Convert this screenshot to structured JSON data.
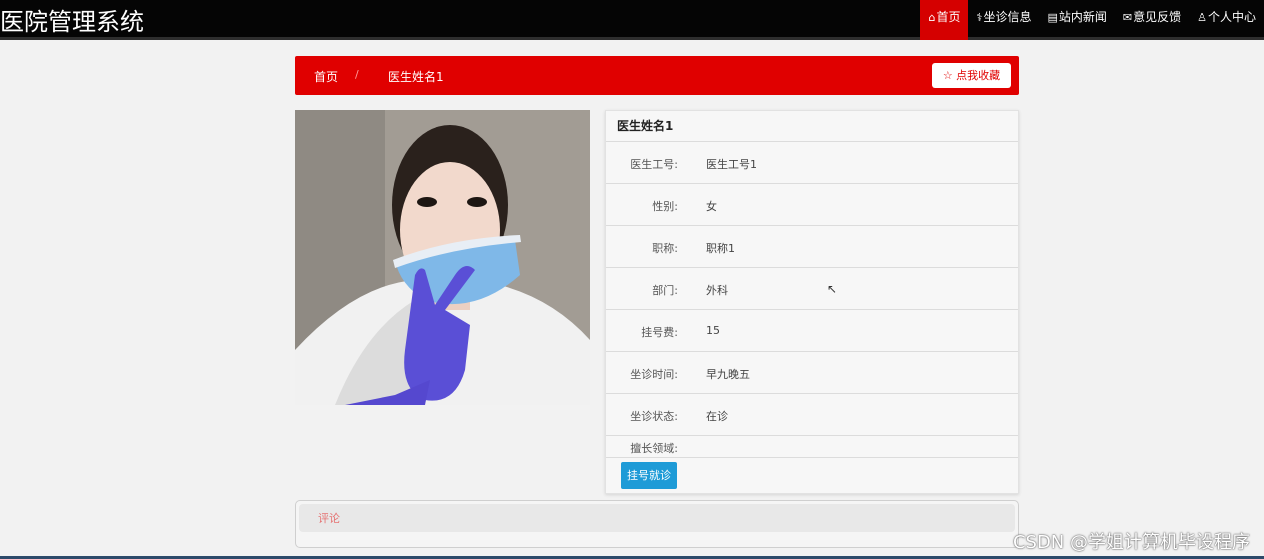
{
  "header": {
    "brand": "医院管理系统",
    "nav": [
      {
        "icon": "⌂",
        "label": "首页",
        "active": true
      },
      {
        "icon": "⚕",
        "label": "坐诊信息"
      },
      {
        "icon": "▤",
        "label": "站内新闻"
      },
      {
        "icon": "✉",
        "label": "意见反馈"
      },
      {
        "icon": "♙",
        "label": "个人中心"
      }
    ]
  },
  "breadcrumb": {
    "home": "首页",
    "separator": "/",
    "current": "医生姓名1",
    "favorite_button": "☆ 点我收藏"
  },
  "doctor": {
    "name": "医生姓名1",
    "fields": [
      {
        "label": "医生工号:",
        "value": "医生工号1"
      },
      {
        "label": "性别:",
        "value": "女"
      },
      {
        "label": "职称:",
        "value": "职称1"
      },
      {
        "label": "部门:",
        "value": "外科"
      },
      {
        "label": "挂号费:",
        "value": "15"
      },
      {
        "label": "坐诊时间:",
        "value": "早九晚五"
      },
      {
        "label": "坐诊状态:",
        "value": "在诊"
      },
      {
        "label": "擅长领域:",
        "value": ""
      }
    ],
    "book_button": "挂号就诊"
  },
  "comments": {
    "title": "评论"
  },
  "watermark": "CSDN @学姐计算机毕设程序",
  "colors": {
    "accent": "#e00000",
    "nav_active": "#d50000",
    "primary_button": "#1e9bd7",
    "topbar": "#050505"
  }
}
